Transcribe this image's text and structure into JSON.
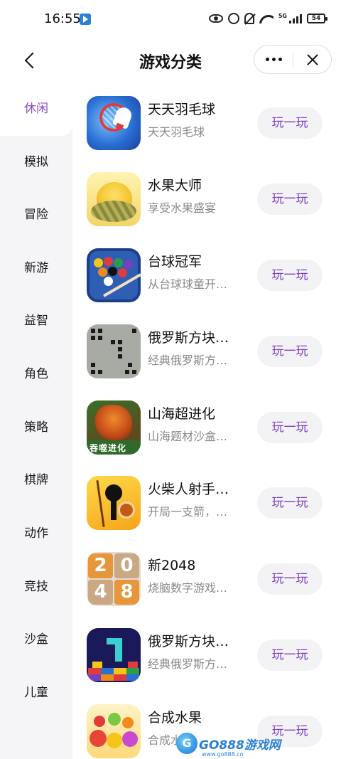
{
  "status_bar": {
    "time": "16:55",
    "network": "5G",
    "battery": "54"
  },
  "header": {
    "title": "游戏分类"
  },
  "sidebar": {
    "categories": [
      {
        "label": "休闲",
        "active": true
      },
      {
        "label": "模拟",
        "active": false
      },
      {
        "label": "冒险",
        "active": false
      },
      {
        "label": "新游",
        "active": false
      },
      {
        "label": "益智",
        "active": false
      },
      {
        "label": "角色",
        "active": false
      },
      {
        "label": "策略",
        "active": false
      },
      {
        "label": "棋牌",
        "active": false
      },
      {
        "label": "动作",
        "active": false
      },
      {
        "label": "竞技",
        "active": false
      },
      {
        "label": "沙盒",
        "active": false
      },
      {
        "label": "儿童",
        "active": false
      }
    ]
  },
  "games": [
    {
      "name": "天天羽毛球",
      "desc": "天天羽毛球",
      "button": "玩一玩",
      "icon": "badminton-icon"
    },
    {
      "name": "水果大师",
      "desc": "享受水果盛宴",
      "button": "玩一玩",
      "icon": "durian-icon"
    },
    {
      "name": "台球冠军",
      "desc": "从台球球童开…",
      "button": "玩一玩",
      "icon": "billiards-icon"
    },
    {
      "name": "俄罗斯方块…",
      "desc": "经典俄罗斯方…",
      "button": "玩一玩",
      "icon": "tetris-icon"
    },
    {
      "name": "山海超进化",
      "desc": "山海题材沙盒…",
      "button": "玩一玩",
      "icon": "dragon-icon"
    },
    {
      "name": "火柴人射手…",
      "desc": "开局一支箭，…",
      "button": "玩一玩",
      "icon": "stickman-icon"
    },
    {
      "name": "新2048",
      "desc": "烧脑数字游戏…",
      "button": "玩一玩",
      "icon": "2048-icon"
    },
    {
      "name": "俄罗斯方块…",
      "desc": "经典俄罗斯方…",
      "button": "玩一玩",
      "icon": "tetris-color-icon"
    },
    {
      "name": "合成水果",
      "desc": "合成水",
      "button": "玩一玩",
      "icon": "merge-fruit-icon"
    }
  ],
  "icon_2048_tiles": [
    "2",
    "0",
    "4",
    "8"
  ],
  "watermark": {
    "logo": "G",
    "text": "GO888游戏网",
    "sub": "www.go888.cn"
  },
  "colors": {
    "accent": "#8b4cc9",
    "button_text": "#7b3fbe",
    "button_bg": "#f3f3f5",
    "sidebar_bg": "#f5f5f7"
  }
}
